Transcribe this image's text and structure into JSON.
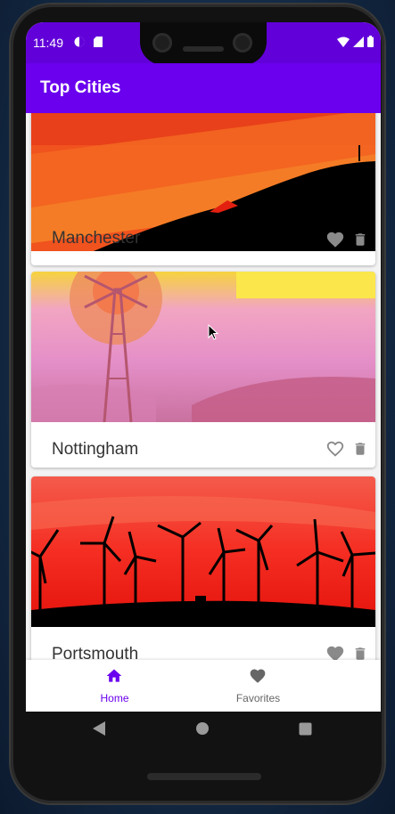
{
  "status_bar": {
    "time": "11:49",
    "icons": [
      "face-icon",
      "sd-card-icon",
      "wifi-icon",
      "signal-icon",
      "battery-icon"
    ]
  },
  "app_bar": {
    "title": "Top Cities",
    "color": "#6a00ee"
  },
  "cities": [
    {
      "name": "Manchester",
      "favorite": true,
      "image": "orange-hillside-silhouette"
    },
    {
      "name": "Nottingham",
      "favorite": false,
      "image": "pink-windmill-sunset"
    },
    {
      "name": "Portsmouth",
      "favorite": true,
      "image": "red-wind-turbines-sunset"
    }
  ],
  "bottom_nav": {
    "items": [
      {
        "label": "Home",
        "icon": "home-icon",
        "active": true
      },
      {
        "label": "Favorites",
        "icon": "heart-icon",
        "active": false
      }
    ],
    "active_color": "#6a00ee",
    "inactive_color": "#666666"
  },
  "system_nav": {
    "icons": [
      "back-icon",
      "home-circle-icon",
      "recents-icon"
    ]
  }
}
